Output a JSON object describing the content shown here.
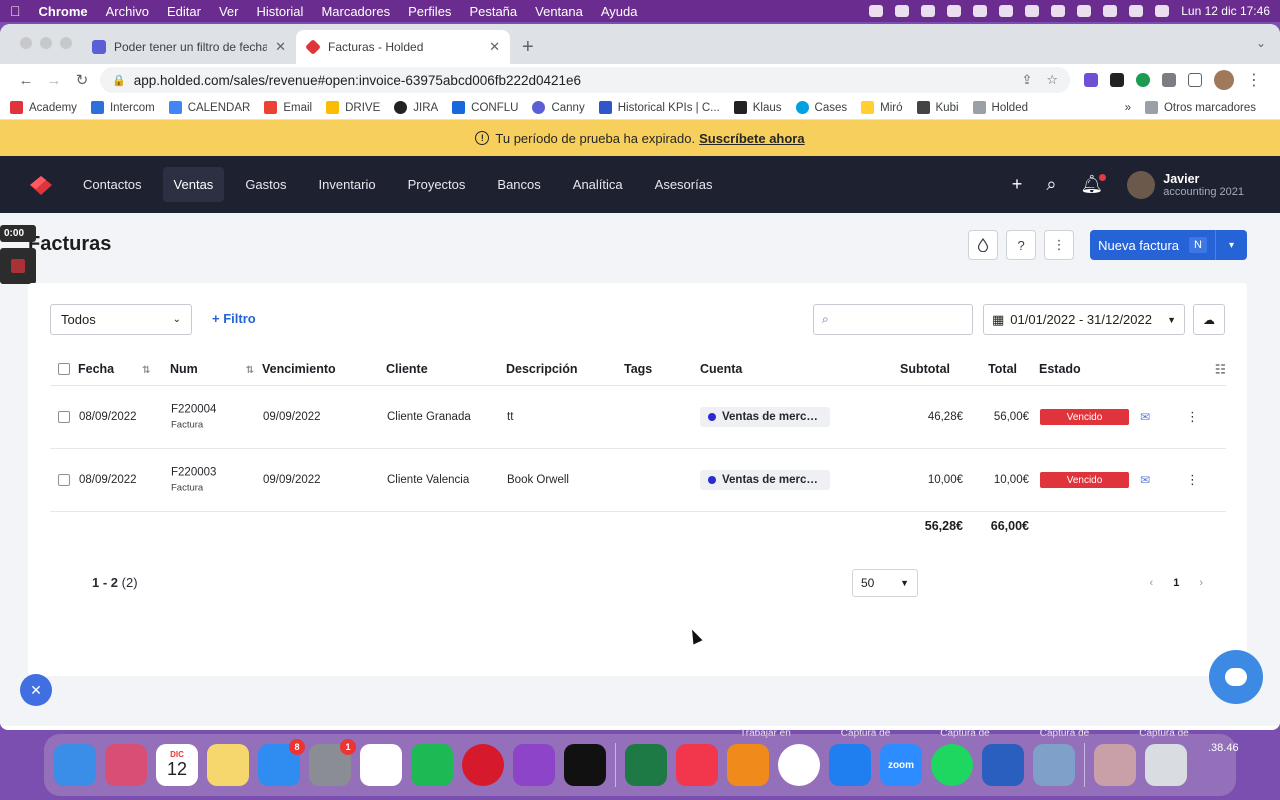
{
  "menubar": {
    "items": [
      "Chrome",
      "Archivo",
      "Editar",
      "Ver",
      "Historial",
      "Marcadores",
      "Perfiles",
      "Pestaña",
      "Ventana",
      "Ayuda"
    ],
    "clock": "Lun 12 dic  17:46"
  },
  "browser": {
    "tabs": [
      {
        "title": "Poder tener un filtro de fechas",
        "active": false
      },
      {
        "title": "Facturas - Holded",
        "active": true
      }
    ],
    "url": "app.holded.com/sales/revenue#open:invoice-63975abcd006fb222d0421e6",
    "bookmarks": [
      "Academy",
      "Intercom",
      "CALENDAR",
      "Email",
      "DRIVE",
      "JIRA",
      "CONFLU",
      "Canny",
      "Historical KPIs | C...",
      "Klaus",
      "Cases",
      "Miró",
      "Kubi",
      "Holded"
    ],
    "bookmarks_more": "»",
    "other_bookmarks": "Otros marcadores"
  },
  "trial_banner": {
    "text": "Tu período de prueba ha expirado.",
    "link": "Suscríbete ahora"
  },
  "nav": {
    "items": [
      "Contactos",
      "Ventas",
      "Gastos",
      "Inventario",
      "Proyectos",
      "Bancos",
      "Analítica",
      "Asesorías"
    ],
    "active": "Ventas",
    "user_name": "Javier",
    "user_sub": "accounting 2021"
  },
  "recorder": {
    "time": "0:00"
  },
  "page": {
    "title": "Facturas",
    "new_invoice_label": "Nueva factura",
    "new_invoice_key": "N"
  },
  "filters": {
    "select_value": "Todos",
    "add_filter_label": "+ Filtro",
    "search_placeholder": "",
    "date_range": "01/01/2022 - 31/12/2022"
  },
  "table": {
    "headers": {
      "fecha": "Fecha",
      "num": "Num",
      "vencimiento": "Vencimiento",
      "cliente": "Cliente",
      "descripcion": "Descripción",
      "tags": "Tags",
      "cuenta": "Cuenta",
      "subtotal": "Subtotal",
      "total": "Total",
      "estado": "Estado"
    },
    "rows": [
      {
        "fecha": "08/09/2022",
        "num": "F220004",
        "num_type": "Factura",
        "vencimiento": "09/09/2022",
        "cliente": "Cliente Granada",
        "descripcion": "tt",
        "cuenta": "Ventas de mercad...",
        "subtotal": "46,28€",
        "total": "56,00€",
        "estado": "Vencido"
      },
      {
        "fecha": "08/09/2022",
        "num": "F220003",
        "num_type": "Factura",
        "vencimiento": "09/09/2022",
        "cliente": "Cliente Valencia",
        "descripcion": "Book Orwell",
        "cuenta": "Ventas de mercad...",
        "subtotal": "10,00€",
        "total": "10,00€",
        "estado": "Vencido"
      }
    ],
    "totals": {
      "subtotal": "56,28€",
      "total": "66,00€"
    }
  },
  "pagination": {
    "range": "1 - 2",
    "count": "(2)",
    "per_page": "50",
    "current_page": "1",
    "prev": "‹",
    "next": "›"
  },
  "desktop": {
    "labels": [
      "Trabajar en",
      "Captura de",
      "Captura de",
      "Captura de",
      "Captura de"
    ],
    "label_tail": ".38.46"
  },
  "dock": {
    "calendar_month": "DIC",
    "calendar_day": "12",
    "appstore_badge": "8",
    "settings_badge": "1",
    "zoom_label": "zoom"
  },
  "colors": {
    "brand_red": "#e0343c",
    "primary_blue": "#2563d6",
    "nav_bg": "#1d2130",
    "trial_yellow": "#f7cf5d"
  }
}
